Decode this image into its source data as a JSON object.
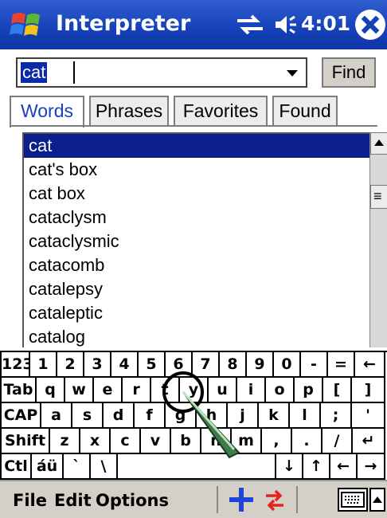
{
  "titlebar": {
    "title": "Interpreter",
    "time": "4:01"
  },
  "search": {
    "value": "cat",
    "find_label": "Find"
  },
  "tabs": [
    {
      "label": "Words",
      "active": true
    },
    {
      "label": "Phrases"
    },
    {
      "label": "Favorites"
    },
    {
      "label": "Found"
    }
  ],
  "list": {
    "items": [
      "cat",
      "cat's box",
      "cat box",
      "cataclysm",
      "cataclysmic",
      "catacomb",
      "catalepsy",
      "cataleptic",
      "catalog"
    ],
    "selected_index": 0
  },
  "keyboard": {
    "row1": [
      "123",
      "1",
      "2",
      "3",
      "4",
      "5",
      "6",
      "7",
      "8",
      "9",
      "0",
      "-",
      "=",
      "←"
    ],
    "row2": [
      "Tab",
      "q",
      "w",
      "e",
      "r",
      "t",
      "y",
      "u",
      "i",
      "o",
      "p",
      "[",
      "]"
    ],
    "row3": [
      "CAP",
      "a",
      "s",
      "d",
      "f",
      "g",
      "h",
      "j",
      "k",
      "l",
      ";",
      "'"
    ],
    "row4": [
      "Shift",
      "z",
      "x",
      "c",
      "v",
      "b",
      "n",
      "m",
      ",",
      ".",
      "/",
      "↵"
    ],
    "row5": [
      "Ctl",
      "áü",
      "`",
      "\\",
      "",
      "↓",
      "↑",
      "←",
      "→"
    ]
  },
  "menubar": {
    "file": "File",
    "edit": "Edit",
    "options": "Options"
  },
  "colors": {
    "titlebar": "#1540b8",
    "selection": "#0a1e8c",
    "tab_active_text": "#1840c0"
  }
}
